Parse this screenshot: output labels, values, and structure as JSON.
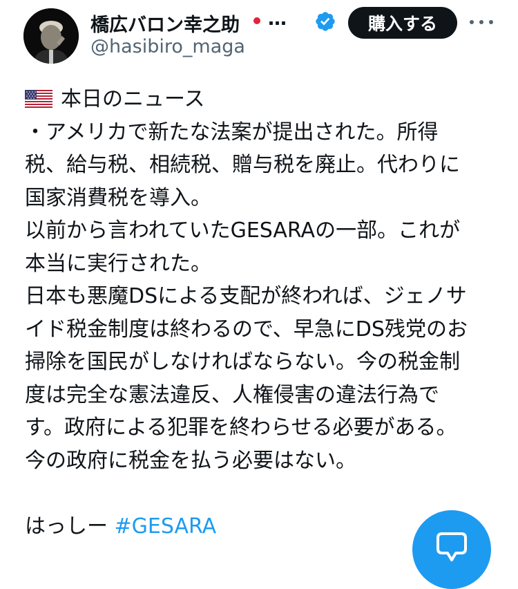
{
  "author": {
    "display_name": "橋広バロン幸之助",
    "name_flag": "japan-flag-emoji",
    "truncation": "…",
    "verified_icon": "verified-badge-icon",
    "handle": "@hasibiro_maga"
  },
  "actions": {
    "buy_label": "購入する",
    "more_icon": "more-horizontal-icon"
  },
  "post": {
    "header_flag": "us-flag-emoji",
    "lines": [
      "本日のニュース",
      "・アメリカで新たな法案が提出された。所得",
      "税、給与税、相続税、贈与税を廃止。代わりに",
      "国家消費税を導入。",
      "以前から言われていたGESARAの一部。これが",
      "本当に実行された。",
      "日本も悪魔DSによる支配が終われば、ジェノサ",
      "イド税金制度は終わるので、早急にDS残党のお",
      "掃除を国民がしなければならない。今の税金制",
      "度は完全な憲法違反、人権侵害の違法行為で",
      "す。政府による犯罪を終わらせる必要がある。",
      "今の政府に税金を払う必要はない。"
    ],
    "signature": "はっしー",
    "hashtag": "#GESARA"
  },
  "fab": {
    "icon": "reply-bubble-icon"
  },
  "colors": {
    "accent": "#1d9bf0",
    "text": "#0f1419",
    "secondary": "#536471"
  }
}
